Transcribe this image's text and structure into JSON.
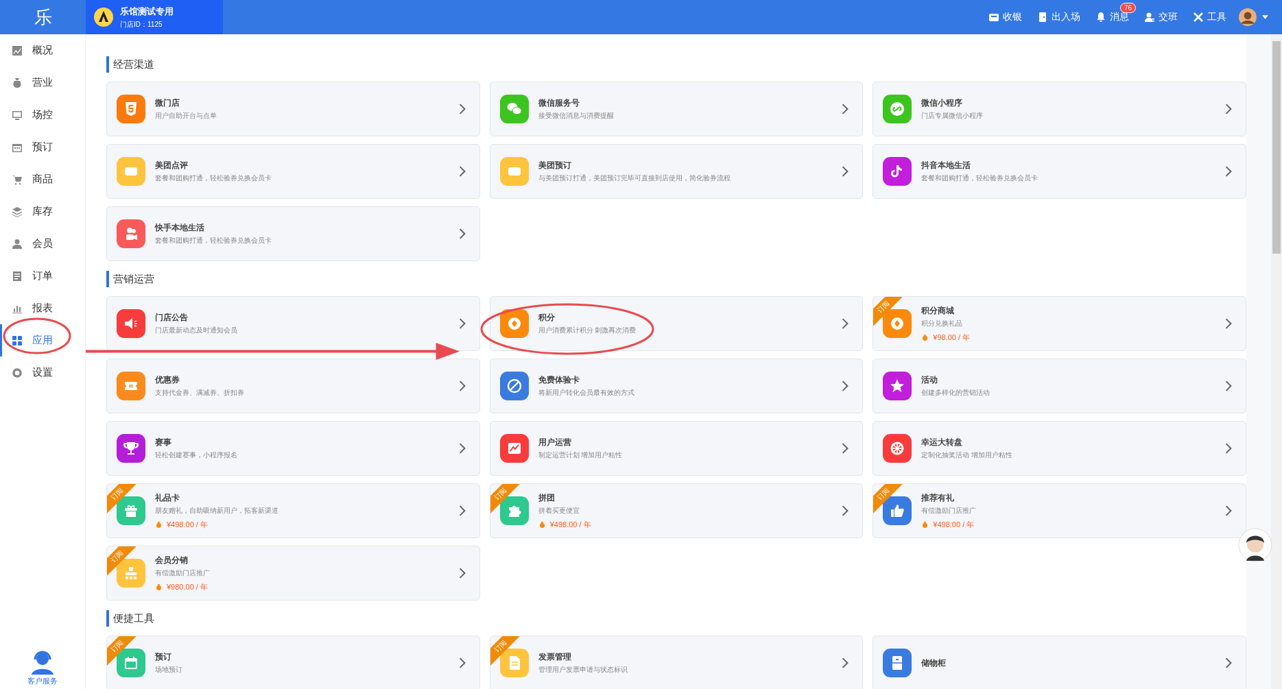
{
  "header": {
    "logo": "乐",
    "store": {
      "name": "乐馆测试专用",
      "id": "门店ID：1125"
    },
    "actions": [
      {
        "label": "收银"
      },
      {
        "label": "出入场"
      },
      {
        "label": "消息",
        "badge": "76"
      },
      {
        "label": "交班"
      },
      {
        "label": "工具"
      }
    ]
  },
  "sidebar": {
    "items": [
      {
        "label": "概况",
        "selected": false
      },
      {
        "label": "营业",
        "selected": false
      },
      {
        "label": "场控",
        "selected": false
      },
      {
        "label": "预订",
        "selected": false
      },
      {
        "label": "商品",
        "selected": false
      },
      {
        "label": "库存",
        "selected": false
      },
      {
        "label": "会员",
        "selected": false
      },
      {
        "label": "订单",
        "selected": false
      },
      {
        "label": "报表",
        "selected": false
      },
      {
        "label": "应用",
        "selected": true
      },
      {
        "label": "设置",
        "selected": false
      }
    ],
    "support": "客户服务"
  },
  "sections": [
    {
      "title": "经营渠道",
      "cards": [
        {
          "title": "微门店",
          "desc": "用户自助开台与点单",
          "color": "#fb7a0c"
        },
        {
          "title": "微信服务号",
          "desc": "接受微信消息与消费提醒",
          "color": "#3cc51f"
        },
        {
          "title": "微信小程序",
          "desc": "门店专属微信小程序",
          "color": "#3cc51f"
        },
        {
          "title": "美团点评",
          "desc": "套餐和团购打通，轻松验券兑换会员卡",
          "color": "#ffc43d"
        },
        {
          "title": "美团预订",
          "desc": "与美团预订打通，美团预订完毕可直接到店使用，简化验券流程",
          "color": "#ffc43d"
        },
        {
          "title": "抖音本地生活",
          "desc": "套餐和团购打通，轻松验券兑换会员卡",
          "color": "#c21edb"
        },
        {
          "title": "快手本地生活",
          "desc": "套餐和团购打通，轻松验券兑换会员卡",
          "color": "#fa5a5a"
        }
      ]
    },
    {
      "title": "营销运营",
      "cards": [
        {
          "title": "门店公告",
          "desc": "门店最新动态及时通知会员",
          "color": "#f83c3c"
        },
        {
          "title": "积分",
          "desc": "用户消费累计积分 刺激再次消费",
          "color": "#fb8a0c"
        },
        {
          "title": "积分商城",
          "desc": "积分兑换礼品",
          "price": "¥98.00 / 年",
          "tag": "订阅",
          "color": "#fb8a0c"
        },
        {
          "title": "优惠券",
          "desc": "支持代金券、满减券、折扣券",
          "color": "#fb8a1c"
        },
        {
          "title": "免费体验卡",
          "desc": "将新用户转化会员最有效的方式",
          "color": "#3a7be0"
        },
        {
          "title": "活动",
          "desc": "创建多样化的营销活动",
          "color": "#c21edb"
        },
        {
          "title": "赛事",
          "desc": "轻松创建赛事，小程序报名",
          "color": "#b51ed8"
        },
        {
          "title": "用户运营",
          "desc": "制定运营计划 增加用户粘性",
          "color": "#f83c3c"
        },
        {
          "title": "幸运大转盘",
          "desc": "定制化抽奖活动 增加用户粘性",
          "color": "#f83c3c"
        },
        {
          "title": "礼品卡",
          "desc": "朋友赠礼，自助吸纳新用户，拓客新渠道",
          "price": "¥498.00 / 年",
          "tag": "订阅",
          "color": "#2ec98f"
        },
        {
          "title": "拼团",
          "desc": "拼着买更便宜",
          "price": "¥498.00 / 年",
          "tag": "订阅",
          "color": "#2ec98f"
        },
        {
          "title": "推荐有礼",
          "desc": "有偿激励门店推广",
          "price": "¥498.00 / 年",
          "tag": "订阅",
          "color": "#3a7be0"
        },
        {
          "title": "会员分销",
          "desc": "有偿激励门店推广",
          "price": "¥980.00 / 年",
          "tag": "订阅",
          "color": "#ffc43d"
        }
      ]
    },
    {
      "title": "便捷工具",
      "cards": [
        {
          "title": "预订",
          "desc": "场地预订",
          "tag": "订阅",
          "color": "#2ec98f"
        },
        {
          "title": "发票管理",
          "desc": "管理用户发票申请与状态标识",
          "tag": "订阅",
          "color": "#ffc43d"
        },
        {
          "title": "储物柜",
          "color": "#3a7be0"
        }
      ]
    }
  ]
}
